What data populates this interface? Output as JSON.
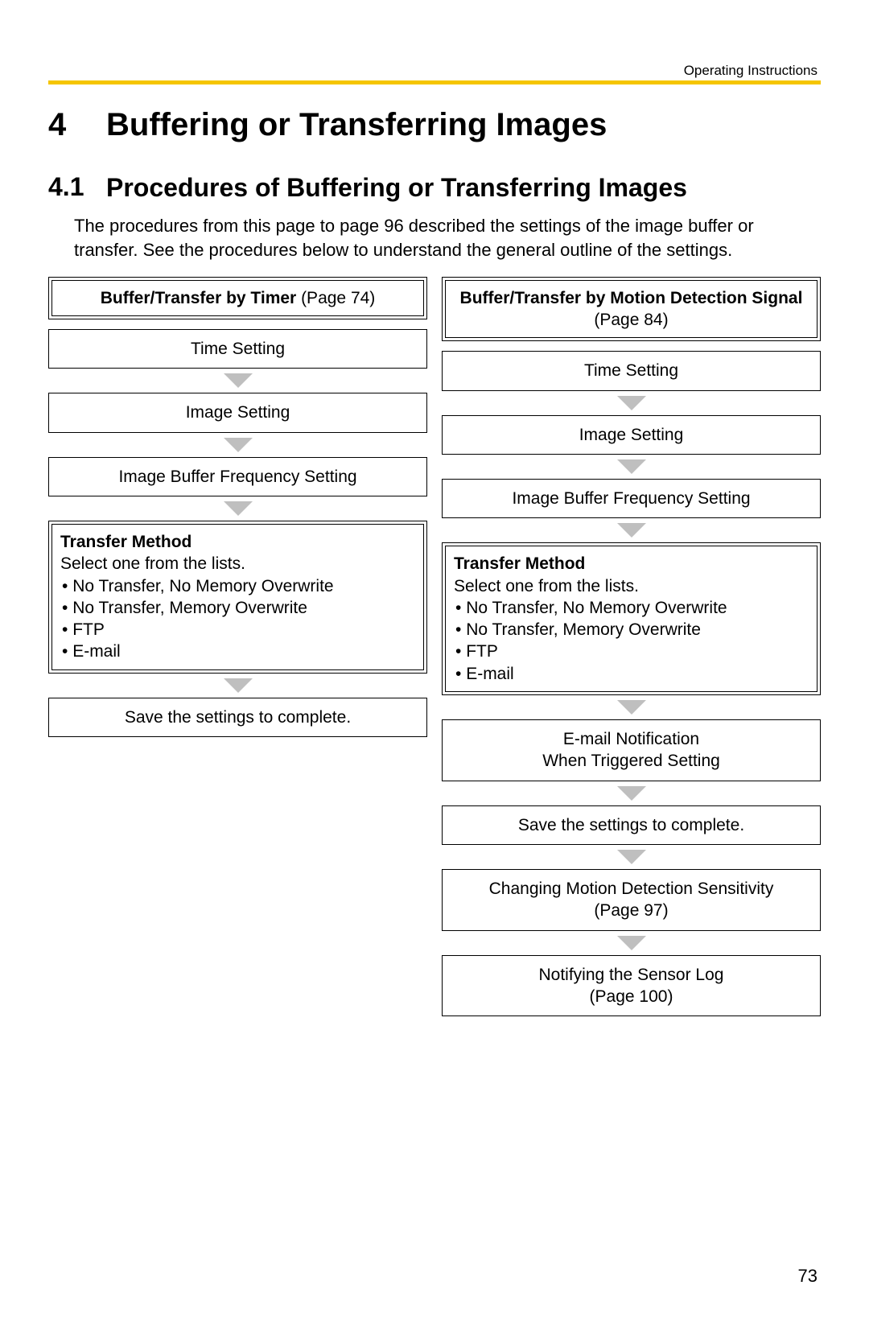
{
  "header": {
    "right": "Operating Instructions"
  },
  "chapter": {
    "num": "4",
    "title": "Buffering or Transferring Images"
  },
  "section": {
    "num": "4.1",
    "title": "Procedures of Buffering or Transferring Images"
  },
  "intro": "The procedures from this page to page 96 described the settings of the image buffer or transfer. See the procedures below to understand the general outline of the settings.",
  "left": {
    "head_bold": "Buffer/Transfer by Timer",
    "head_tail": " (Page 74)",
    "s1": "Time Setting",
    "s2": "Image Setting",
    "s3": "Image Buffer Frequency Setting",
    "tm_title": "Transfer Method",
    "tm_sub": "Select one from the lists.",
    "tm_items": [
      "No Transfer, No Memory Overwrite",
      "No Transfer, Memory Overwrite",
      "FTP",
      "E-mail"
    ],
    "s5": "Save the settings to complete."
  },
  "right": {
    "head_bold": "Buffer/Transfer by Motion Detection Signal",
    "head_tail": " (Page 84)",
    "s1": "Time Setting",
    "s2": "Image Setting",
    "s3": "Image Buffer Frequency Setting",
    "tm_title": "Transfer Method",
    "tm_sub": "Select one from the lists.",
    "tm_items": [
      "No Transfer, No Memory Overwrite",
      "No Transfer, Memory Overwrite",
      "FTP",
      "E-mail"
    ],
    "s5a": "E-mail Notification",
    "s5b": "When Triggered Setting",
    "s6": "Save the settings to complete.",
    "s7a": "Changing Motion Detection Sensitivity",
    "s7b": "(Page 97)",
    "s8a": "Notifying the Sensor Log",
    "s8b": "(Page 100)"
  },
  "pagenum": "73"
}
